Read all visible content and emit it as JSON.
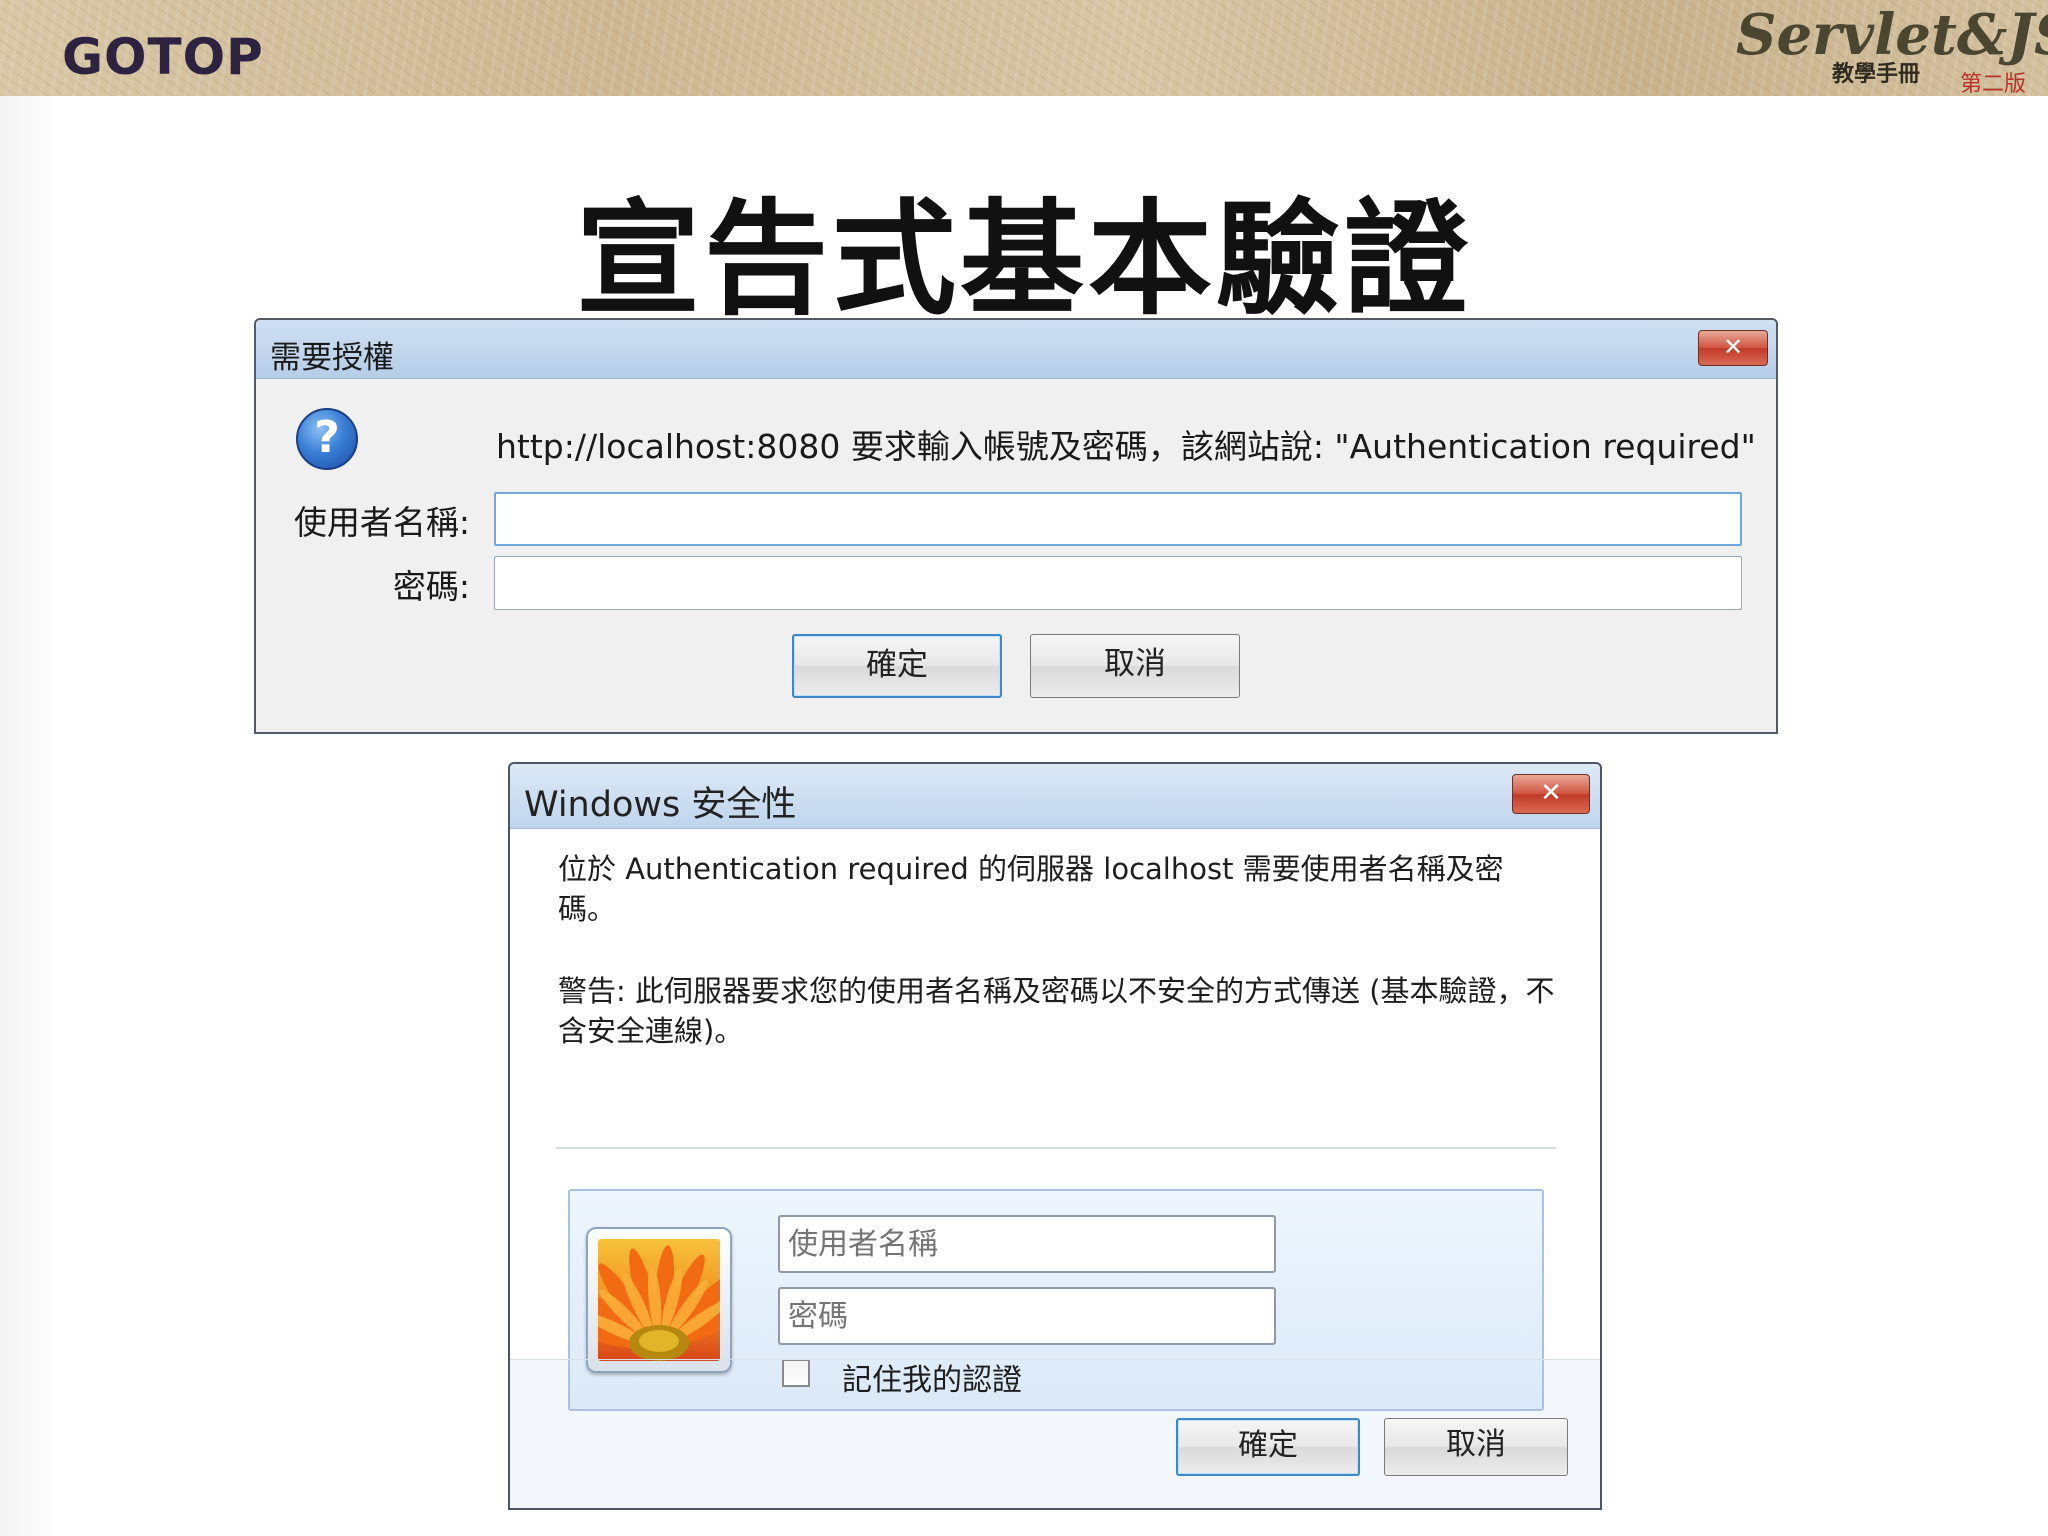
{
  "slide": {
    "publisher_logo": "GOTOP",
    "book_logo": {
      "title": "Servlet&JSP",
      "subtitle": "教學手冊",
      "edition": "第二版"
    },
    "title": "宣告式基本驗證"
  },
  "firefox_dialog": {
    "title": "需要授權",
    "close_label": "✕",
    "icon": "help-question-icon",
    "message": "http://localhost:8080 要求輸入帳號及密碼，該網站說: \"Authentication required\"",
    "username_label": "使用者名稱:",
    "username_value": "",
    "password_label": "密碼:",
    "password_value": "",
    "ok_label": "確定",
    "cancel_label": "取消"
  },
  "windows_dialog": {
    "title": "Windows 安全性",
    "close_label": "✕",
    "message": "位於 Authentication required 的伺服器 localhost 需要使用者名稱及密碼。",
    "warning": "警告: 此伺服器要求您的使用者名稱及密碼以不安全的方式傳送 (基本驗證，不含安全連線)。",
    "avatar_icon": "user-avatar-flower-icon",
    "username_placeholder": "使用者名稱",
    "password_placeholder": "密碼",
    "remember_label": "記住我的認證",
    "remember_checked": false,
    "ok_label": "確定",
    "cancel_label": "取消"
  },
  "colors": {
    "titlebar_blue": "#b6cde8",
    "close_red": "#c03a28",
    "default_button_border": "#3c88c9"
  }
}
